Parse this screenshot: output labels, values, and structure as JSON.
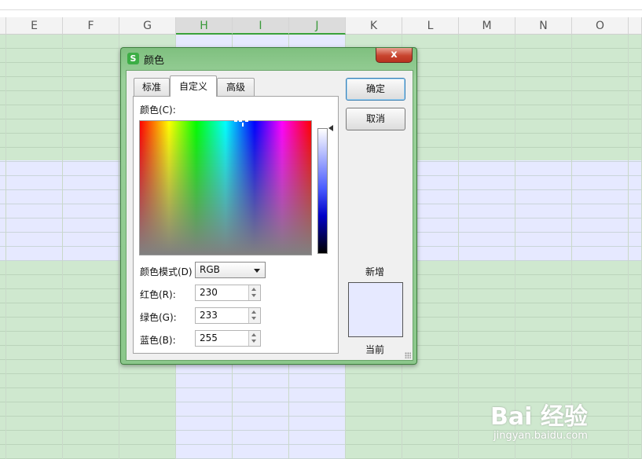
{
  "sheet": {
    "columns": [
      "E",
      "F",
      "G",
      "H",
      "I",
      "J",
      "K",
      "L",
      "M",
      "N",
      "O"
    ],
    "selected_columns": [
      "H",
      "I",
      "J"
    ],
    "colors": {
      "green_fill": "#cfe8cf",
      "lavender_fill": "#e6e9ff",
      "selected_header_text": "#3a9a3a"
    }
  },
  "dialog": {
    "title": "颜色",
    "app_icon_letter": "S",
    "close_glyph": "x",
    "tabs": [
      {
        "label": "标准",
        "active": false
      },
      {
        "label": "自定义",
        "active": true
      },
      {
        "label": "高级",
        "active": false
      }
    ],
    "color_label": "颜色(C):",
    "mode_label": "颜色模式(D)",
    "mode_value": "RGB",
    "red_label": "红色(R):",
    "red_value": "230",
    "green_label": "绿色(G):",
    "green_value": "233",
    "blue_label": "蓝色(B):",
    "blue_value": "255",
    "ok_label": "确定",
    "cancel_label": "取消",
    "new_label": "新增",
    "current_label": "当前",
    "new_color": "#e6e9ff"
  },
  "watermark": {
    "logo": "Bai 经验",
    "url": "jingyan.baidu.com"
  }
}
